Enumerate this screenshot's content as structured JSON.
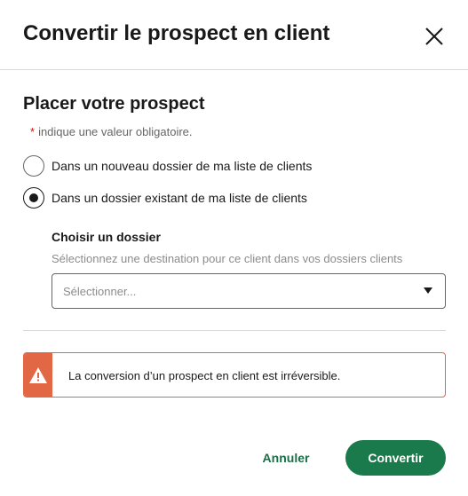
{
  "dialog": {
    "title": "Convertir le prospect en client",
    "close_icon": "close-icon"
  },
  "form": {
    "section_title": "Placer votre prospect",
    "required_star": "*",
    "required_text": "indique une valeur obligatoire.",
    "options": [
      {
        "label": "Dans un nouveau dossier de ma liste de clients",
        "selected": false
      },
      {
        "label": "Dans un dossier existant de ma liste de clients",
        "selected": true
      }
    ],
    "folder": {
      "label": "Choisir un dossier",
      "hint": "Sélectionnez une destination pour ce client dans vos dossiers clients",
      "select_value": "Sélectionner...",
      "caret_icon": "caret-down-icon"
    }
  },
  "alert": {
    "icon": "warning-icon",
    "text": "La conversion d’un prospect en client est irréversible.",
    "color": "#e16745"
  },
  "actions": {
    "cancel_label": "Annuler",
    "convert_label": "Convertir",
    "primary_color": "#1b7a4b"
  }
}
